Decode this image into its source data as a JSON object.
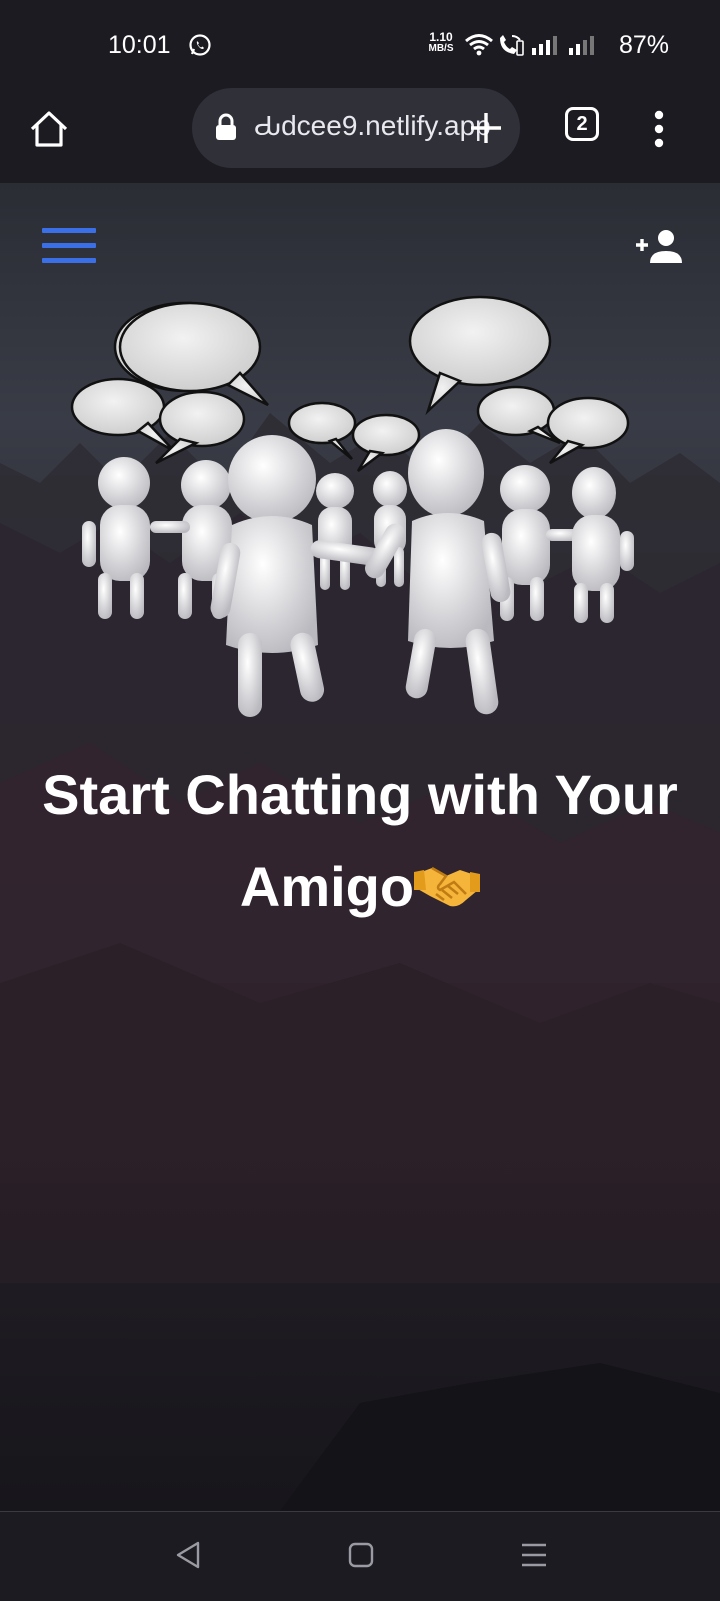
{
  "status_bar": {
    "time": "10:01",
    "net_speed_value": "1.10",
    "net_speed_unit": "MB/S",
    "battery": "87%",
    "icons": [
      "whatsapp-icon",
      "wifi-icon",
      "wifi-call-icon",
      "sim2-signal-icon",
      "sim1-signal-icon"
    ]
  },
  "browser": {
    "url": "Ԃdcee9.netlify.app",
    "tab_count": "2",
    "icons": [
      "home-icon",
      "lock-icon",
      "plus-icon",
      "more-vert-icon"
    ]
  },
  "page": {
    "headline_line1": "Start Chatting with Your",
    "headline_line2": "Amigo",
    "headline_emoji": "handshake-emoji",
    "menu_icon": "hamburger-menu-icon",
    "add_user_icon": "person-add-icon",
    "accent_color": "#3a6fe8"
  },
  "nav_bar": {
    "icons": [
      "back-icon",
      "home-square-icon",
      "recent-apps-icon"
    ]
  }
}
